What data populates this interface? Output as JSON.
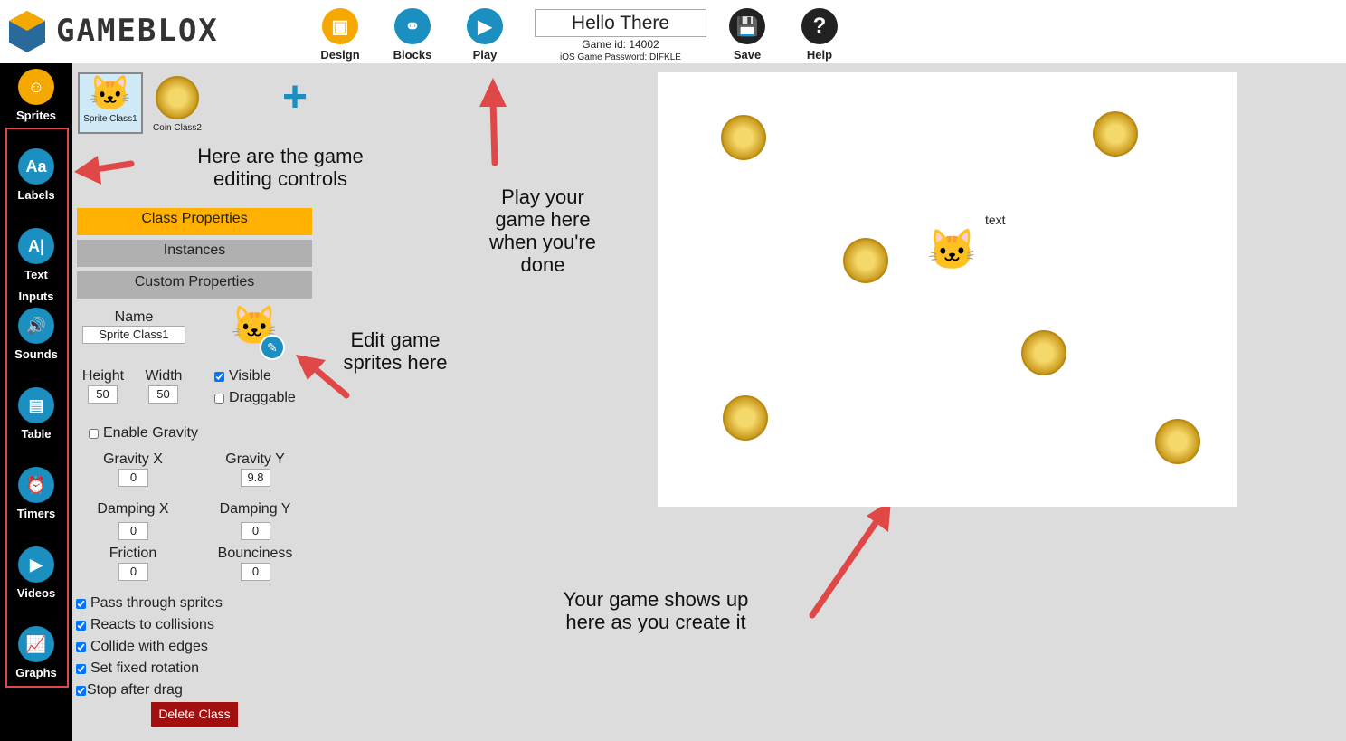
{
  "app": {
    "brand": "GAMEBLOX",
    "title": "Hello There",
    "game_id": "Game id: 14002",
    "ios_password": "iOS Game Password: DIFKLE"
  },
  "nav": [
    {
      "label": "Design",
      "icon": "image-icon",
      "color": "#f5a900"
    },
    {
      "label": "Blocks",
      "icon": "blocks-icon",
      "color": "#1a8fc0"
    },
    {
      "label": "Play",
      "icon": "play-icon",
      "color": "#1a8fc0"
    },
    {
      "label": "Save",
      "icon": "save-icon",
      "color": "#222"
    },
    {
      "label": "Help",
      "icon": "help-icon",
      "color": "#222"
    }
  ],
  "sidebar": [
    {
      "label": "Sprites",
      "icon": "sprite-icon"
    },
    {
      "label": "Labels",
      "icon": "labels-icon",
      "glyph": "Aa"
    },
    {
      "label": "Text Inputs",
      "icon": "text-input-icon",
      "glyph": "A|"
    },
    {
      "label": "Sounds",
      "icon": "sound-icon",
      "glyph": "🔊"
    },
    {
      "label": "Table",
      "icon": "table-icon",
      "glyph": "▤"
    },
    {
      "label": "Timers",
      "icon": "timer-icon",
      "glyph": "⏰"
    },
    {
      "label": "Videos",
      "icon": "video-icon",
      "glyph": "▶"
    },
    {
      "label": "Graphs",
      "icon": "graph-icon",
      "glyph": "📈"
    }
  ],
  "classes": [
    {
      "label": "Sprite Class1",
      "selected": true
    },
    {
      "label": "Coin Class2"
    }
  ],
  "tabs": {
    "class_properties": "Class Properties",
    "instances": "Instances",
    "custom_properties": "Custom Properties"
  },
  "props": {
    "name_label": "Name",
    "name": "Sprite Class1",
    "height_label": "Height",
    "height": "50",
    "width_label": "Width",
    "width": "50",
    "visible": "Visible",
    "draggable": "Draggable",
    "enable_gravity": "Enable Gravity",
    "gravity_x_label": "Gravity X",
    "gravity_x": "0",
    "gravity_y_label": "Gravity Y",
    "gravity_y": "9.8",
    "damping_x_label": "Damping X",
    "damping_x": "0",
    "damping_y_label": "Damping Y",
    "damping_y": "0",
    "friction_label": "Friction",
    "friction": "0",
    "bounciness_label": "Bounciness",
    "bounciness": "0",
    "pass_through": "Pass through sprites",
    "reacts": "Reacts to collisions",
    "collide": "Collide with edges",
    "fixed_rotation": "Set fixed rotation",
    "stop_drag": "Stop after drag",
    "delete": "Delete Class"
  },
  "annotations": {
    "controls": "Here are the game editing controls",
    "play": "Play your game here when you're done",
    "sprites": "Edit game sprites here",
    "game": "Your game shows up here as you create it"
  },
  "canvas": {
    "text_label": "text"
  },
  "colors": {
    "accent": "#f5a900",
    "blue": "#1a8fc0",
    "delete": "#a30f0f",
    "arrow": "#e04848"
  }
}
